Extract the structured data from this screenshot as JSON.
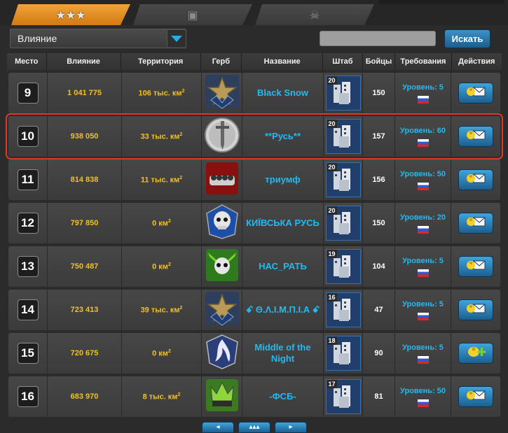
{
  "tabs": [
    {
      "icon": "stars-icon",
      "glyph": "★★★"
    },
    {
      "icon": "hq-icon",
      "glyph": "▣"
    },
    {
      "icon": "skull-wings-icon",
      "glyph": "☠"
    }
  ],
  "filter": {
    "selected": "Влияние"
  },
  "search": {
    "placeholder": "",
    "value": "",
    "button_label": "Искать"
  },
  "columns": [
    "Место",
    "Влияние",
    "Территория",
    "Герб",
    "Название",
    "Штаб",
    "Бойцы",
    "Требования",
    "Действия"
  ],
  "rows": [
    {
      "rank": "9",
      "influence": "1 041 775",
      "territory": "106 тыс. км",
      "crest": "star-crest",
      "name": "Black Snow",
      "hq_level": "20",
      "fighters": "150",
      "requirement": "Уровень: 5",
      "action": "mail-icon",
      "highlight": false
    },
    {
      "rank": "10",
      "influence": "938 050",
      "territory": "33 тыс. км",
      "crest": "sword-crest",
      "name": "**Русь**",
      "hq_level": "20",
      "fighters": "157",
      "requirement": "Уровень: 60",
      "action": "mail-icon",
      "highlight": true
    },
    {
      "rank": "11",
      "influence": "814 838",
      "territory": "11 тыс. км",
      "crest": "knuckles-crest",
      "name": "триумф",
      "hq_level": "20",
      "fighters": "156",
      "requirement": "Уровень: 50",
      "action": "mail-icon",
      "highlight": false
    },
    {
      "rank": "12",
      "influence": "797 850",
      "territory": "0 км",
      "crest": "skull-blue-crest",
      "name": "КИЇВСЬКА РУСЬ",
      "hq_level": "20",
      "fighters": "150",
      "requirement": "Уровень: 20",
      "action": "mail-icon",
      "highlight": false
    },
    {
      "rank": "13",
      "influence": "750 487",
      "territory": "0 км",
      "crest": "skull-green-crest",
      "name": "НАС_РАТЬ",
      "hq_level": "19",
      "fighters": "104",
      "requirement": "Уровень: 5",
      "action": "mail-icon",
      "highlight": false
    },
    {
      "rank": "14",
      "influence": "723 413",
      "territory": "39 тыс. км",
      "crest": "star-crest",
      "name": "ꗃ Θ.Λ.Ι.Μ.Π.Ι.Α ꗃ",
      "hq_level": "16",
      "fighters": "47",
      "requirement": "Уровень: 5",
      "action": "mail-icon",
      "highlight": false
    },
    {
      "rank": "15",
      "influence": "720 675",
      "territory": "0 км",
      "crest": "flame-crest",
      "name": "Middle of the Night",
      "hq_level": "18",
      "fighters": "90",
      "requirement": "Уровень: 5",
      "action": "join-icon",
      "highlight": false
    },
    {
      "rank": "16",
      "influence": "683 970",
      "territory": "8 тыс. км",
      "crest": "crown-crest",
      "name": "-ФСБ-",
      "hq_level": "17",
      "fighters": "81",
      "requirement": "Уровень: 50",
      "action": "mail-icon",
      "highlight": false
    }
  ],
  "colors": {
    "accent_tab": "#e08f20",
    "link_blue": "#24b9f0",
    "value_gold": "#f2c020",
    "highlight_red": "#d93a2b"
  }
}
